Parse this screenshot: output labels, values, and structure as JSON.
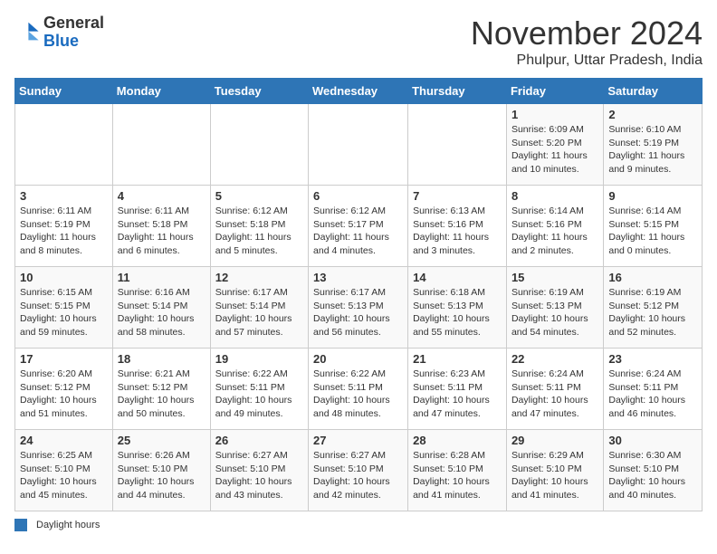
{
  "logo": {
    "general": "General",
    "blue": "Blue"
  },
  "header": {
    "month_title": "November 2024",
    "location": "Phulpur, Uttar Pradesh, India"
  },
  "days_of_week": [
    "Sunday",
    "Monday",
    "Tuesday",
    "Wednesday",
    "Thursday",
    "Friday",
    "Saturday"
  ],
  "weeks": [
    [
      {
        "day": "",
        "info": ""
      },
      {
        "day": "",
        "info": ""
      },
      {
        "day": "",
        "info": ""
      },
      {
        "day": "",
        "info": ""
      },
      {
        "day": "",
        "info": ""
      },
      {
        "day": "1",
        "info": "Sunrise: 6:09 AM\nSunset: 5:20 PM\nDaylight: 11 hours and 10 minutes."
      },
      {
        "day": "2",
        "info": "Sunrise: 6:10 AM\nSunset: 5:19 PM\nDaylight: 11 hours and 9 minutes."
      }
    ],
    [
      {
        "day": "3",
        "info": "Sunrise: 6:11 AM\nSunset: 5:19 PM\nDaylight: 11 hours and 8 minutes."
      },
      {
        "day": "4",
        "info": "Sunrise: 6:11 AM\nSunset: 5:18 PM\nDaylight: 11 hours and 6 minutes."
      },
      {
        "day": "5",
        "info": "Sunrise: 6:12 AM\nSunset: 5:18 PM\nDaylight: 11 hours and 5 minutes."
      },
      {
        "day": "6",
        "info": "Sunrise: 6:12 AM\nSunset: 5:17 PM\nDaylight: 11 hours and 4 minutes."
      },
      {
        "day": "7",
        "info": "Sunrise: 6:13 AM\nSunset: 5:16 PM\nDaylight: 11 hours and 3 minutes."
      },
      {
        "day": "8",
        "info": "Sunrise: 6:14 AM\nSunset: 5:16 PM\nDaylight: 11 hours and 2 minutes."
      },
      {
        "day": "9",
        "info": "Sunrise: 6:14 AM\nSunset: 5:15 PM\nDaylight: 11 hours and 0 minutes."
      }
    ],
    [
      {
        "day": "10",
        "info": "Sunrise: 6:15 AM\nSunset: 5:15 PM\nDaylight: 10 hours and 59 minutes."
      },
      {
        "day": "11",
        "info": "Sunrise: 6:16 AM\nSunset: 5:14 PM\nDaylight: 10 hours and 58 minutes."
      },
      {
        "day": "12",
        "info": "Sunrise: 6:17 AM\nSunset: 5:14 PM\nDaylight: 10 hours and 57 minutes."
      },
      {
        "day": "13",
        "info": "Sunrise: 6:17 AM\nSunset: 5:13 PM\nDaylight: 10 hours and 56 minutes."
      },
      {
        "day": "14",
        "info": "Sunrise: 6:18 AM\nSunset: 5:13 PM\nDaylight: 10 hours and 55 minutes."
      },
      {
        "day": "15",
        "info": "Sunrise: 6:19 AM\nSunset: 5:13 PM\nDaylight: 10 hours and 54 minutes."
      },
      {
        "day": "16",
        "info": "Sunrise: 6:19 AM\nSunset: 5:12 PM\nDaylight: 10 hours and 52 minutes."
      }
    ],
    [
      {
        "day": "17",
        "info": "Sunrise: 6:20 AM\nSunset: 5:12 PM\nDaylight: 10 hours and 51 minutes."
      },
      {
        "day": "18",
        "info": "Sunrise: 6:21 AM\nSunset: 5:12 PM\nDaylight: 10 hours and 50 minutes."
      },
      {
        "day": "19",
        "info": "Sunrise: 6:22 AM\nSunset: 5:11 PM\nDaylight: 10 hours and 49 minutes."
      },
      {
        "day": "20",
        "info": "Sunrise: 6:22 AM\nSunset: 5:11 PM\nDaylight: 10 hours and 48 minutes."
      },
      {
        "day": "21",
        "info": "Sunrise: 6:23 AM\nSunset: 5:11 PM\nDaylight: 10 hours and 47 minutes."
      },
      {
        "day": "22",
        "info": "Sunrise: 6:24 AM\nSunset: 5:11 PM\nDaylight: 10 hours and 47 minutes."
      },
      {
        "day": "23",
        "info": "Sunrise: 6:24 AM\nSunset: 5:11 PM\nDaylight: 10 hours and 46 minutes."
      }
    ],
    [
      {
        "day": "24",
        "info": "Sunrise: 6:25 AM\nSunset: 5:10 PM\nDaylight: 10 hours and 45 minutes."
      },
      {
        "day": "25",
        "info": "Sunrise: 6:26 AM\nSunset: 5:10 PM\nDaylight: 10 hours and 44 minutes."
      },
      {
        "day": "26",
        "info": "Sunrise: 6:27 AM\nSunset: 5:10 PM\nDaylight: 10 hours and 43 minutes."
      },
      {
        "day": "27",
        "info": "Sunrise: 6:27 AM\nSunset: 5:10 PM\nDaylight: 10 hours and 42 minutes."
      },
      {
        "day": "28",
        "info": "Sunrise: 6:28 AM\nSunset: 5:10 PM\nDaylight: 10 hours and 41 minutes."
      },
      {
        "day": "29",
        "info": "Sunrise: 6:29 AM\nSunset: 5:10 PM\nDaylight: 10 hours and 41 minutes."
      },
      {
        "day": "30",
        "info": "Sunrise: 6:30 AM\nSunset: 5:10 PM\nDaylight: 10 hours and 40 minutes."
      }
    ]
  ],
  "footer": {
    "legend_label": "Daylight hours"
  }
}
